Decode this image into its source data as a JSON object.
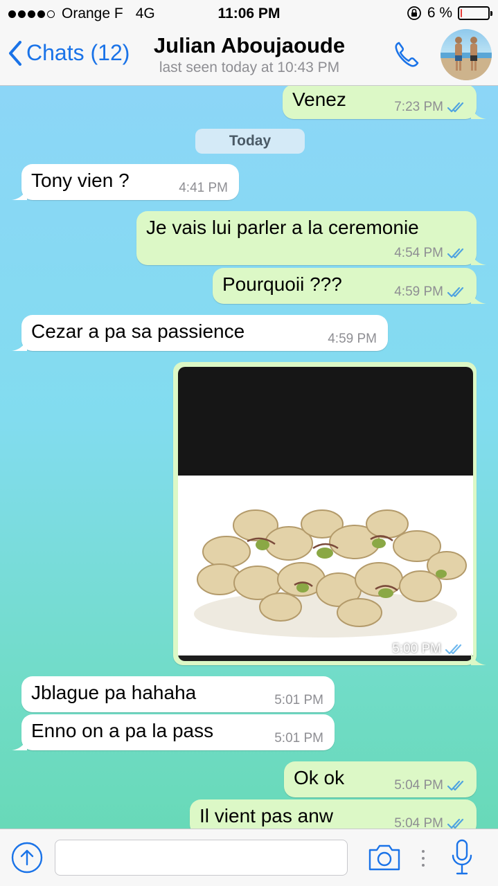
{
  "status_bar": {
    "carrier": "Orange F",
    "network": "4G",
    "time": "11:06 PM",
    "battery_percent_text": "6 %",
    "battery_level": 0.06,
    "signal_bars_filled": 4,
    "signal_bars_total": 5,
    "icons": [
      "signal-dots-icon",
      "orientation-lock-icon",
      "battery-icon"
    ]
  },
  "header": {
    "back_label": "Chats (12)",
    "contact_name": "Julian Aboujaoude",
    "last_seen": "last seen today at 10:43 PM",
    "icons": [
      "chevron-left-icon",
      "phone-icon",
      "contact-avatar"
    ]
  },
  "day_separator": "Today",
  "messages": [
    {
      "direction": "out",
      "text": "Venez",
      "time": "7:23 PM",
      "status": "read"
    },
    {
      "direction": "in",
      "text": "Tony vien ?",
      "time": "4:41 PM"
    },
    {
      "direction": "out",
      "text": "Je vais lui parler a la ceremonie",
      "time": "4:54 PM",
      "status": "read"
    },
    {
      "direction": "out",
      "text": "Pourquoii ???",
      "time": "4:59 PM",
      "status": "read"
    },
    {
      "direction": "in",
      "text": "Cezar a pa sa passience",
      "time": "4:59 PM"
    },
    {
      "direction": "out",
      "type": "image",
      "image_subject": "pistachios",
      "time": "5:00 PM",
      "status": "read"
    },
    {
      "direction": "in",
      "text": "Jblague pa hahaha",
      "time": "5:01 PM"
    },
    {
      "direction": "in",
      "text": "Enno on a pa la pass",
      "time": "5:01 PM"
    },
    {
      "direction": "out",
      "text": "Ok ok",
      "time": "5:04 PM",
      "status": "read"
    },
    {
      "direction": "out",
      "text": "Il vient pas anw",
      "time": "5:04 PM",
      "status": "read"
    }
  ],
  "input_bar": {
    "placeholder": "",
    "icons": [
      "attach-upload-icon",
      "camera-icon",
      "more-dots-icon",
      "microphone-icon"
    ]
  },
  "colors": {
    "accent": "#1a73e8",
    "outgoing_bubble": "#dcf8c6",
    "incoming_bubble": "#ffffff",
    "read_ticks": "#4fa3e0",
    "chat_bg_top": "#8cd6f7",
    "chat_bg_bottom": "#68d9b8",
    "battery_low": "#e53935"
  }
}
